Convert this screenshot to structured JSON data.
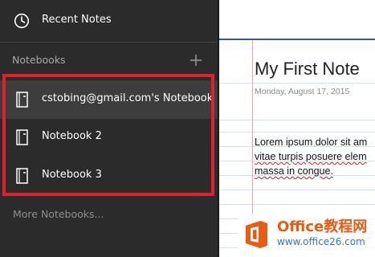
{
  "nav": {
    "recent_label": "Recent Notes",
    "recent_icon": "clock-icon",
    "notebooks_header": "Notebooks",
    "add_icon": "plus-icon",
    "notebooks": [
      {
        "label": "cstobing@gmail.com's Notebook",
        "icon": "notebook-icon",
        "selected": true
      },
      {
        "label": "Notebook 2",
        "icon": "notebook-icon",
        "selected": false
      },
      {
        "label": "Notebook 3",
        "icon": "notebook-icon",
        "selected": false
      }
    ],
    "more_label": "More Notebooks..."
  },
  "page": {
    "title": "My First Note",
    "date": "Monday, August 17, 2015",
    "body_lines": [
      "Lorem ipsum dolor sit am",
      "vitae turpis posuere elem",
      "massa in congue."
    ]
  },
  "watermark": {
    "title": "Office教程网",
    "url": "www.office26.com"
  },
  "colors": {
    "pane_bg": "#2b2b2b",
    "selected_bg": "#3d3d3d",
    "highlight_border": "#e0202a",
    "page_rule": "#2d5c8f",
    "brand_orange": "#e85b10"
  }
}
